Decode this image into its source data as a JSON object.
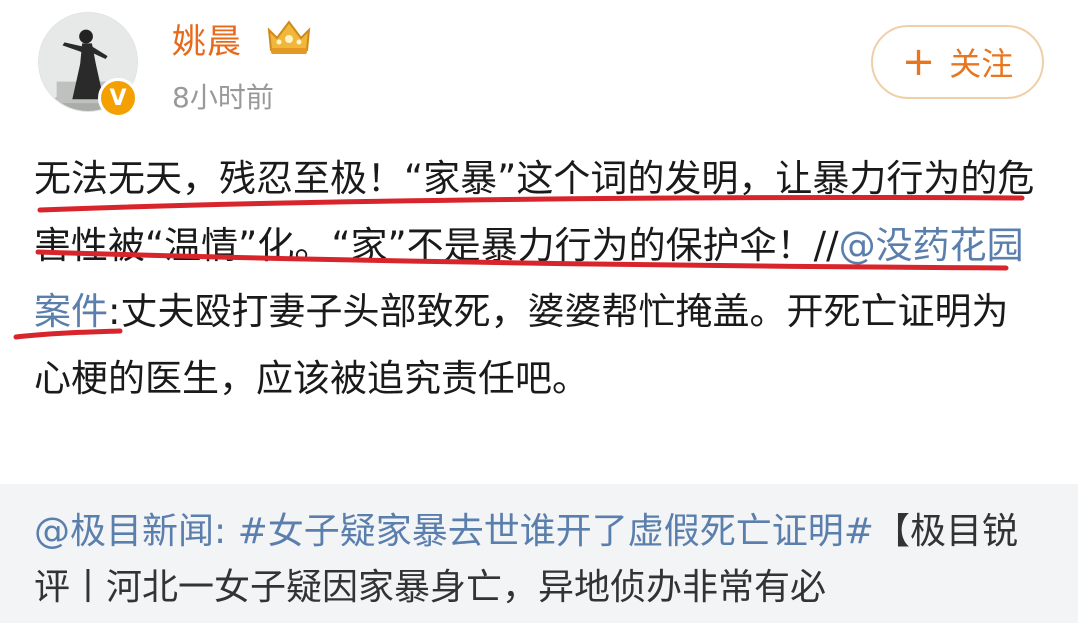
{
  "user": {
    "name": "姚晨",
    "time": "8小时前",
    "verified_mark": "V",
    "crown_icon": "crown-icon",
    "avatar_icon": "avatar-image"
  },
  "follow_button": {
    "plus": "+",
    "label": "关注"
  },
  "post": {
    "text_1": "无法无天，残忍至极！“家暴”这个词的发明，让暴力行为的危害性被“温情”化。“家”不是暴力行为的保护伞！//",
    "mention": "@没药花园案件",
    "text_2": ":丈夫殴打妻子头部致死，婆婆帮忙掩盖。开死亡证明为心梗的医生，应该被追究责任吧。"
  },
  "repost": {
    "mention": "@极目新闻:",
    "hashtag": "#女子疑家暴去世谁开了虚假死亡证明#",
    "text": "【极目锐评丨河北一女子疑因家暴身亡，异地侦办非常有必"
  },
  "colors": {
    "username": "#e76a1c",
    "link": "#5b7fad",
    "underline": "#d8252c",
    "follow_border": "#f0cfa7",
    "repost_bg": "#f3f4f6"
  }
}
